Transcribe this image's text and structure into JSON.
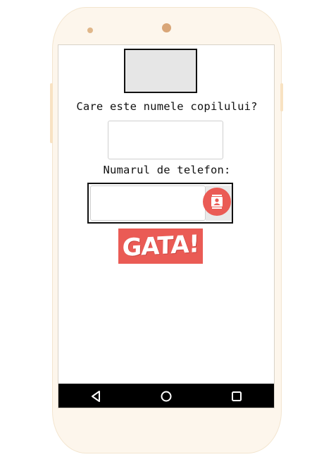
{
  "form": {
    "question_label": "Care este numele copilului?",
    "name_value": "",
    "phone_label": "Numarul de telefon:",
    "phone_value": "",
    "done_label": "GATA!"
  },
  "icons": {
    "contact": "contacts-icon",
    "back": "back-triangle-icon",
    "home": "home-circle-icon",
    "recent": "recent-square-icon"
  },
  "colors": {
    "accent": "#ea5b55",
    "phone_frame": "#fdf6ec",
    "navbar": "#000000"
  }
}
